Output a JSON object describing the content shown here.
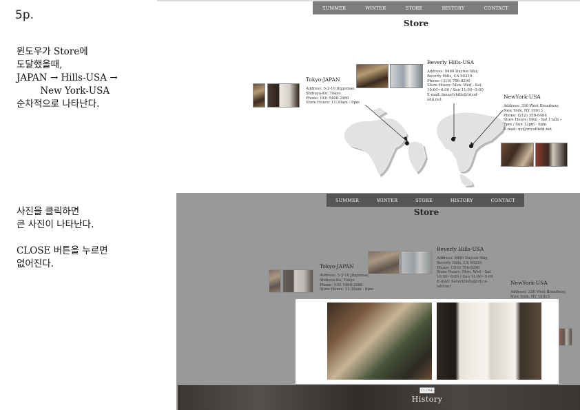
{
  "page_number": "5p.",
  "note_top": {
    "lines": [
      "윈도우가 Store에",
      "도달했을때,",
      "JAPAN → Hills-USA →",
      "        New York-USA",
      "순차적으로 나타난다."
    ]
  },
  "note_bottom": {
    "lines": [
      "사진을 클릭하면",
      "큰 사진이 나타난다.",
      "",
      "CLOSE 버튼을 누르면",
      "없어진다."
    ]
  },
  "nav": {
    "items": [
      "SUMMER",
      "WINTER",
      "STORE",
      "HISTORY",
      "CONTACT"
    ]
  },
  "store_title": "Store",
  "locations": {
    "tokyo": {
      "name": "Tokyo-JAPAN",
      "lines": [
        "Address: 5-2-10 Jingumae,",
        "Shibuya-Ku, Tokyo",
        "Phone: (03) 5468-2980",
        "Store Hours: 11:30am - 8pm"
      ]
    },
    "beverly": {
      "name": "Beverly Hills-USA",
      "lines": [
        "Address: 9460 Dayton Way,",
        "Beverly Hills, CA 90210",
        "Phone: (310) 786-8290",
        "Store Hours: Mon, Wed - Sat",
        "10:00~6:00 / Sun 11:00~5:00",
        "E-mail: beverlyhills@tricol-",
        "ield.net"
      ]
    },
    "newyork": {
      "name": "NewYork-USA",
      "lines": [
        "Address: 330 West Broadway,",
        "New York, NY 10013",
        "Phone: (212) 358-8484",
        "Store Hours: Mon - Sat 11am -",
        "7pm / Sun 12pm - 6pm",
        "E-mail: ny@tricolfield.net"
      ]
    }
  },
  "modal": {
    "close_label": "CLOSE"
  },
  "history_label": "History",
  "colors": {
    "nav_bg": "#7d7d7d",
    "overlay": "#999999",
    "map": "#e2e2e2"
  }
}
